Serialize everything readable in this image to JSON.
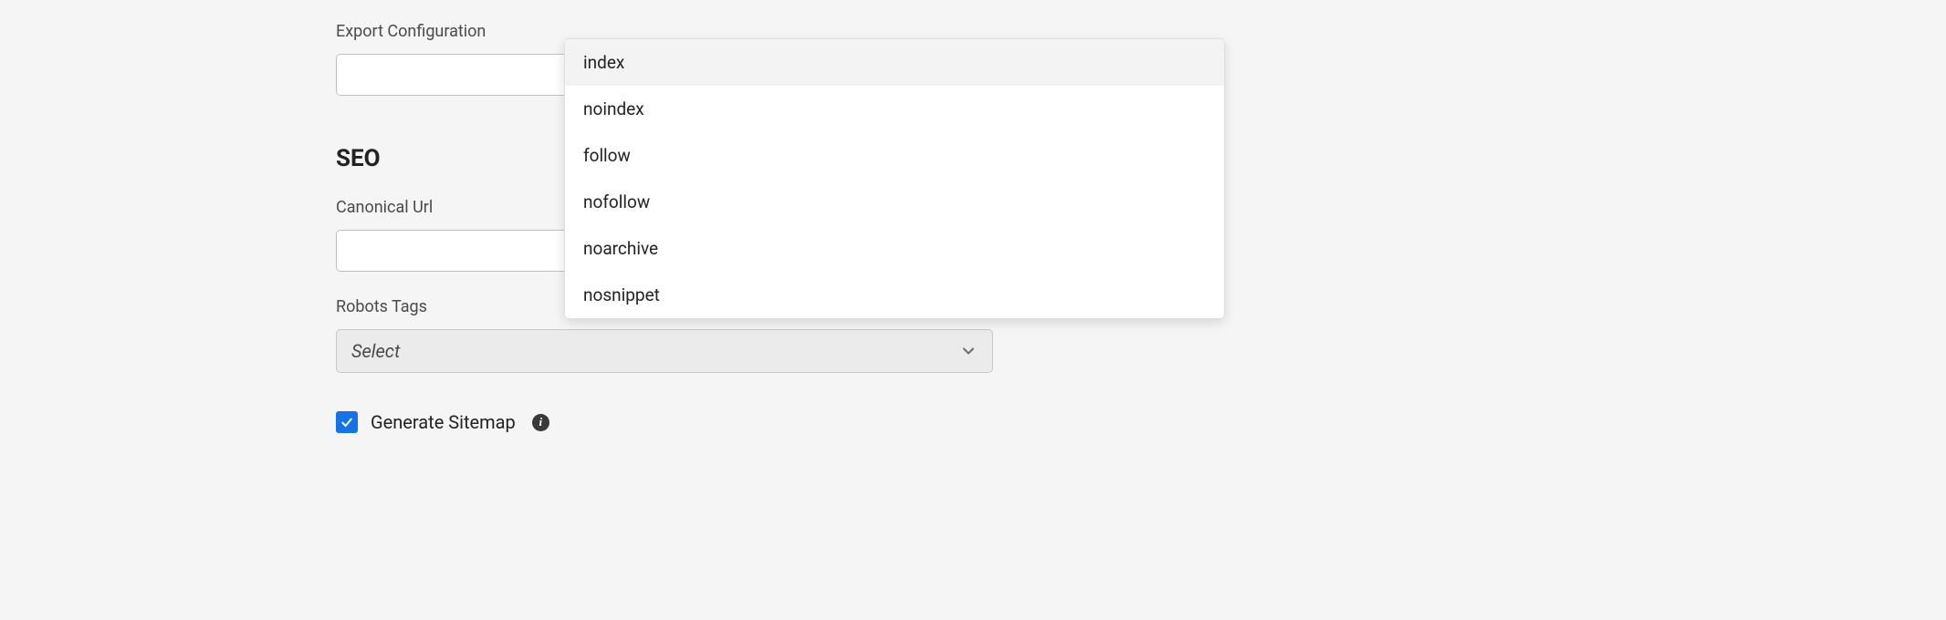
{
  "exportConfig": {
    "label": "Export Configuration",
    "value": ""
  },
  "seo": {
    "heading": "SEO",
    "canonicalUrl": {
      "label": "Canonical Url",
      "value": ""
    },
    "robotsTags": {
      "label": "Robots Tags",
      "placeholder": "Select",
      "options": [
        "index",
        "noindex",
        "follow",
        "nofollow",
        "noarchive",
        "nosnippet"
      ],
      "highlightedIndex": 0
    },
    "generateSitemap": {
      "label": "Generate Sitemap",
      "checked": true
    }
  }
}
